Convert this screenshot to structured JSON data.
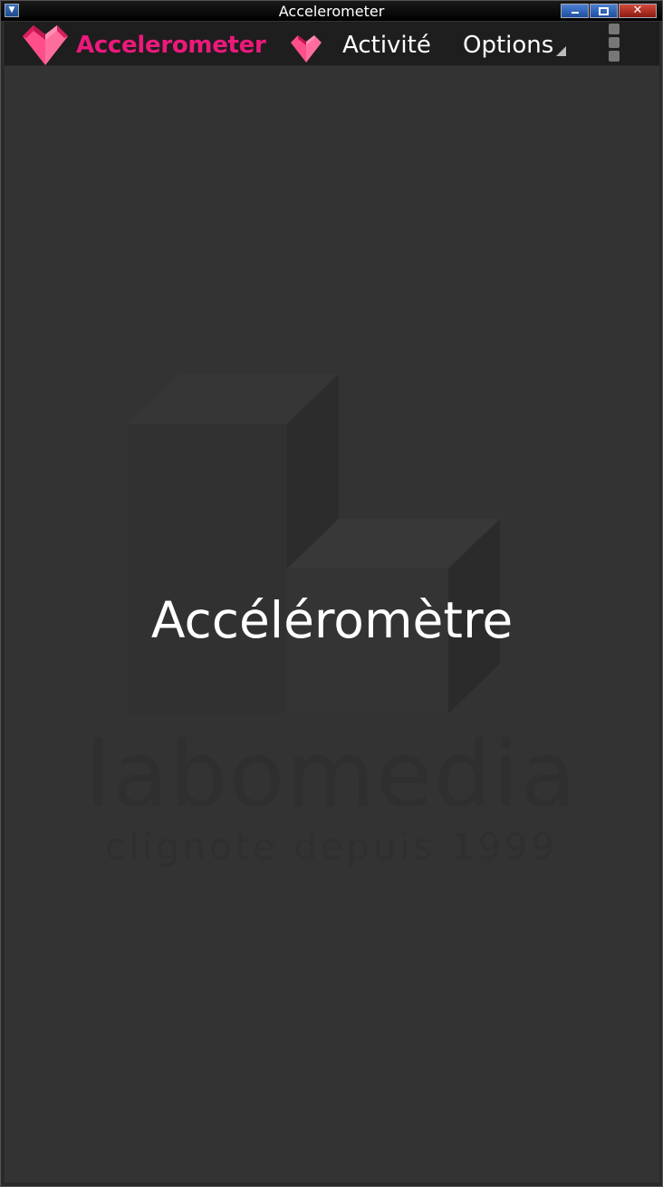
{
  "window": {
    "title": "Accelerometer",
    "minimize_icon": "minimize-icon",
    "maximize_icon": "maximize-icon",
    "close_glyph": "✕"
  },
  "appbar": {
    "brand": "Accelerometer",
    "brand_icon": "heart-logo-icon",
    "activity_icon": "heart-icon",
    "activity_label": "Activité",
    "options_label": "Options",
    "overflow_icon": "overflow-menu-icon"
  },
  "main": {
    "center_text": "Accéléromètre",
    "watermark_brand": "labomedia",
    "watermark_tagline": "clignote depuis 1999"
  },
  "colors": {
    "accent": "#ec197b",
    "heart_pink": "#ff4f8a",
    "background": "#333333",
    "appbar": "#1e1e1e"
  }
}
